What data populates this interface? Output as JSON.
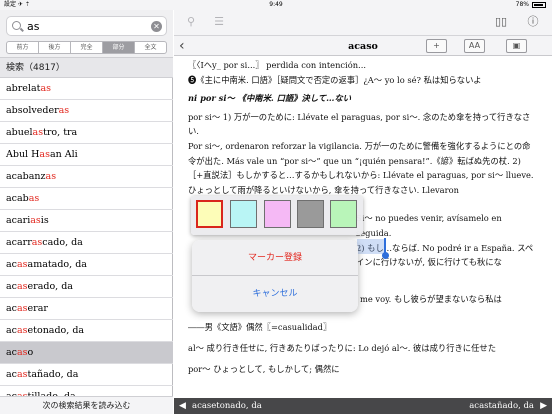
{
  "status": {
    "left": "設定  ✈  ⇡",
    "time": "9:49",
    "battery": "78%"
  },
  "search": {
    "value": "as",
    "clear": "✕"
  },
  "modes": [
    {
      "label": "前方",
      "on": false
    },
    {
      "label": "後方",
      "on": false
    },
    {
      "label": "完全",
      "on": false
    },
    {
      "label": "部分",
      "on": true
    },
    {
      "label": "全文",
      "on": false
    }
  ],
  "results_header": "検索（4817）",
  "results": [
    {
      "pre": "abrelat",
      "hit": "as",
      "post": "",
      "sel": false
    },
    {
      "pre": "absolveder",
      "hit": "as",
      "post": "",
      "sel": false
    },
    {
      "pre": "abuel",
      "hit": "as",
      "post": "tro, tra",
      "sel": false
    },
    {
      "pre": "Abul H",
      "hit": "as",
      "post": "an Ali",
      "sel": false
    },
    {
      "pre": "acabanz",
      "hit": "as",
      "post": "",
      "sel": false
    },
    {
      "pre": "acab",
      "hit": "as",
      "post": "",
      "sel": false
    },
    {
      "pre": "acari",
      "hit": "as",
      "post": "is",
      "sel": false
    },
    {
      "pre": "acarr",
      "hit": "as",
      "post": "cado, da",
      "sel": false
    },
    {
      "pre": "ac",
      "hit": "as",
      "post": "amatado, da",
      "sel": false
    },
    {
      "pre": "ac",
      "hit": "as",
      "post": "erado, da",
      "sel": false
    },
    {
      "pre": "ac",
      "hit": "as",
      "post": "erar",
      "sel": false
    },
    {
      "pre": "ac",
      "hit": "as",
      "post": "etonado, da",
      "sel": false
    },
    {
      "pre": "ac",
      "hit": "as",
      "post": "o",
      "sel": true
    },
    {
      "pre": "ac",
      "hit": "as",
      "post": "tañado, da",
      "sel": false
    },
    {
      "pre": "ac",
      "hit": "as",
      "post": "tillado, da",
      "sel": false
    }
  ],
  "more_results": "次の検索結果を読み込む",
  "entry": {
    "title": "acaso",
    "back": "‹",
    "btn_add": "+",
    "btn_font": "AA",
    "btn_view": "▣",
    "lines": [
      "〖〈Iヘy_ por si...〗 perdida con intención...",
      "❺《主に中南米. 口語》［疑問文で否定の返事］¿A〜 yo lo sé? 私は知らないよ",
      "ni por si〜 《中南米. 口語》決して…ない",
      "por si〜  1) 万が一のために: Llévate el paraguas, por si〜. 念のため傘を持って行きなさい.",
      "Por si〜, ordenaron reforzar la vigilancia. 万が一のために警備を強化するようにとの命令が出た. Más vale un “por si〜” que un “¡quién pensara!”.《諺》転ばぬ先の杖.  2)［+直説法］もしかすると…するかもしれないから: Llévate el paraguas, por si〜 llueve. ひょっとして雨が降るといけないから, 傘を持って行きなさい. Llevaron",
      "Si〜 no puedes venir, avísamelo en seguida.",
      "2) もし…ならば. No podré ir a España. スペインに行けないが, 仮に行けても秋にな",
      "me voy. もし彼らが望まないなら私は",
      "――男《文語》偶然〖=casualidad〗",
      "al〜 成り行き任せに, 行きあたりばったりに: Lo dejó al〜. 彼は成り行きに任せた",
      "por〜 ひょっとして, もしかして; 偶然に"
    ]
  },
  "popup": {
    "register": "マーカー登録",
    "cancel": "キャンセル"
  },
  "swatches": [
    "#fdfdb8",
    "#b9f5f5",
    "#f5b9f5",
    "#9a9a9a",
    "#b9f5b9"
  ],
  "footer": {
    "prev": "acasetonado, da",
    "next": "acastañado, da",
    "prev_arrow": "◀",
    "next_arrow": "▶"
  }
}
